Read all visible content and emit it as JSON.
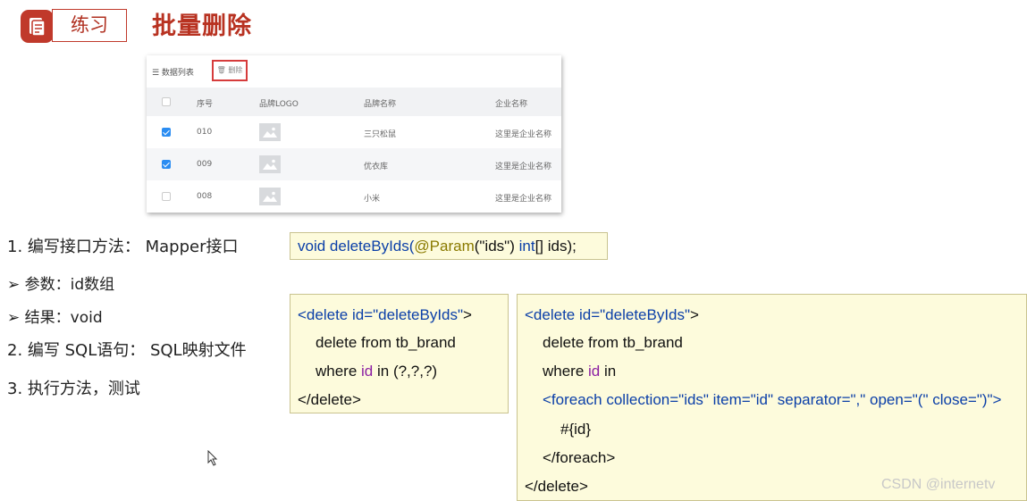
{
  "header": {
    "badge": "练习",
    "title": "批量删除"
  },
  "table_panel": {
    "list_label": "☰ 数据列表",
    "delete_button": "🗑 删除",
    "columns": [
      "序号",
      "品牌LOGO",
      "品牌名称",
      "企业名称"
    ],
    "rows": [
      {
        "checked": true,
        "id": "010",
        "brand": "三只松鼠",
        "company": "这里是企业名称"
      },
      {
        "checked": true,
        "id": "009",
        "brand": "优衣库",
        "company": "这里是企业名称"
      },
      {
        "checked": false,
        "id": "008",
        "brand": "小米",
        "company": "这里是企业名称"
      }
    ]
  },
  "steps": [
    "1.  编写接口方法：  Mapper接口",
    "➢   参数：id数组",
    "➢   结果：void",
    "2.  编写 SQL语句：  SQL映射文件",
    "3.  执行方法，测试"
  ],
  "code_interface": {
    "p1": "void deleteByIds(",
    "anno": "@Param",
    "p2": "(\"ids\") ",
    "p3": "int",
    "p4": "[] ids);"
  },
  "code_sql_simple": {
    "l1_tag": "<delete",
    "l1_attr": " id=",
    "l1_val": "\"deleteByIds\"",
    "l1_end": ">",
    "l2": "delete from tb_brand",
    "l3_a": "where ",
    "l3_b": "id",
    "l3_c": " in (?,?,?)",
    "l4": "</delete>"
  },
  "code_sql_foreach": {
    "l1_tag": "<delete",
    "l1_attr": " id=",
    "l1_val": "\"deleteByIds\"",
    "l1_end": ">",
    "l2": "delete from tb_brand",
    "l3_a": "where ",
    "l3_b": "id",
    "l3_c": " in",
    "l4": "<foreach collection=\"ids\" item=\"id\" separator=\",\" open=\"(\" close=\")\">",
    "l5": "#{id}",
    "l6": "</foreach>",
    "l7": "</delete>"
  },
  "watermark": "CSDN @internetv"
}
